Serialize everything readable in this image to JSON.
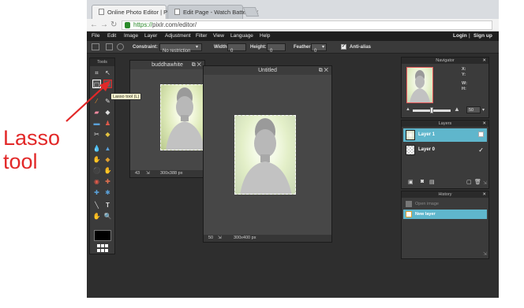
{
  "browser": {
    "tabs": [
      {
        "label": "Online Photo Editor | Pixl"
      },
      {
        "label": "Edit Page - Watch Battery"
      }
    ],
    "url_scheme": "https://",
    "url_rest": "pixlr.com/editor/"
  },
  "menu": {
    "items": [
      "File",
      "Edit",
      "Image",
      "Layer",
      "Adjustment",
      "Filter",
      "View",
      "Language",
      "Help"
    ],
    "login": "Login",
    "separator": "|",
    "signup": "Sign up"
  },
  "options": {
    "constraint_label": "Constraint:",
    "constraint_value": "No restriction",
    "width_label": "Width:",
    "width_value": "0",
    "height_label": "Height:",
    "height_value": "0",
    "feather_label": "Feather:",
    "feather_value": "0",
    "antialias_label": "Anti-alias"
  },
  "tools_panel": {
    "title": "Tools",
    "tooltip": "Lasso tool (L)"
  },
  "window_buddha": {
    "title": "buddhawhite",
    "zoom": "43",
    "size": "300x388 px"
  },
  "window_untitled": {
    "title": "Untitled",
    "zoom": "50",
    "size": "300x400 px"
  },
  "navigator": {
    "title": "Navigator",
    "x_label": "X:",
    "y_label": "Y:",
    "w_label": "W:",
    "h_label": "H:",
    "zoom_value": "50"
  },
  "layers": {
    "title": "Layers",
    "items": [
      {
        "label": "Layer 1"
      },
      {
        "label": "Layer 0"
      }
    ]
  },
  "history": {
    "title": "History",
    "items": [
      {
        "label": "Open image"
      },
      {
        "label": "New layer"
      }
    ]
  },
  "annotation": {
    "line1": "Lasso",
    "line2": "tool"
  },
  "colors": {
    "annotation": "#e22828",
    "selection_highlight": "#5fb6cc",
    "workspace": "#2e2e2e"
  }
}
